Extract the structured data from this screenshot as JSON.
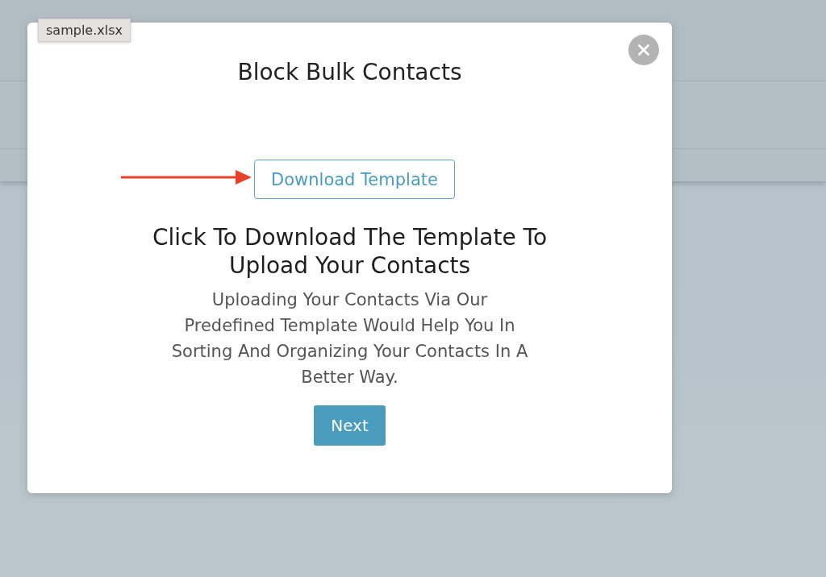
{
  "tooltip": {
    "text": "sample.xlsx"
  },
  "dialog": {
    "title": "Block Bulk Contacts",
    "download_button": {
      "label": "Download Template"
    },
    "heading": "Click To Download The Template To Upload Your Contacts",
    "description": "Uploading Your Contacts Via Our Predefined Template Would Help You In Sorting And Organizing Your Contacts In A Better Way.",
    "next_button": {
      "label": "Next"
    }
  }
}
